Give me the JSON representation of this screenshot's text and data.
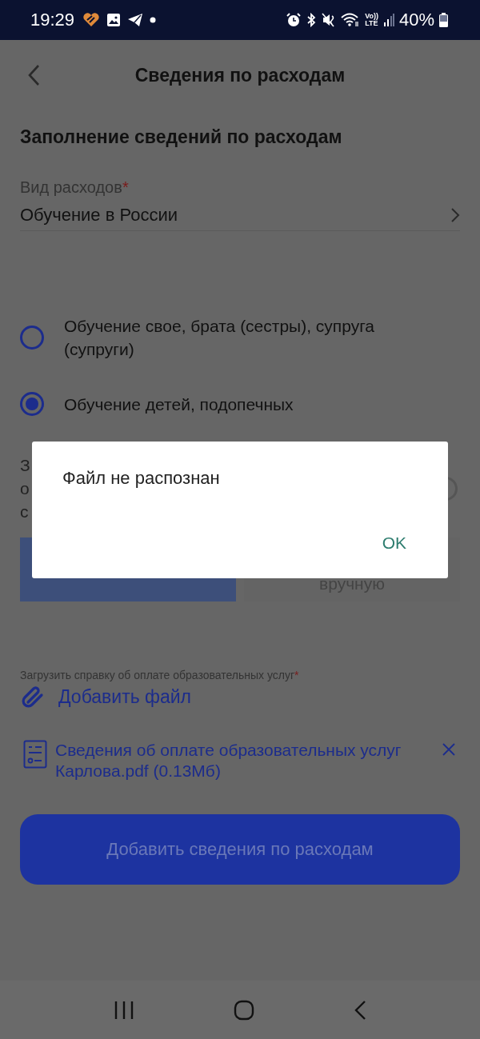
{
  "status_bar": {
    "time": "19:29",
    "volte": "Vo))",
    "lte": "LTE",
    "battery": "40%"
  },
  "header": {
    "title": "Сведения по расходам"
  },
  "section_title": "Заполнение сведений по расходам",
  "expense_field": {
    "label": "Вид расходов",
    "required": true,
    "required_mark": "*",
    "value": "Обучение в России"
  },
  "options": [
    {
      "label": "Обучение свое, брата (сестры), супруга (супруги)",
      "selected": false
    },
    {
      "label": "Обучение детей, подопечных",
      "selected": true
    }
  ],
  "covered_text_lines": [
    "З",
    "о",
    "с"
  ],
  "covered_radio": {
    "selected": false
  },
  "input_mode": [
    {
      "selected": true
    },
    {
      "label": "вручную",
      "selected": false
    }
  ],
  "upload": {
    "label": "Загрузить справку об оплате образовательных услуг",
    "required": true,
    "required_mark": "*",
    "add_link": "Добавить файл"
  },
  "files": [
    {
      "name": "Сведения об оплате образовательных услуг Карлова.pdf (0.13Мб)"
    }
  ],
  "submit_button": {
    "label": "Добавить сведения по расходам",
    "disabled": true
  },
  "dialog": {
    "message": "Файл не распознан",
    "buttons": [
      "OK"
    ]
  }
}
